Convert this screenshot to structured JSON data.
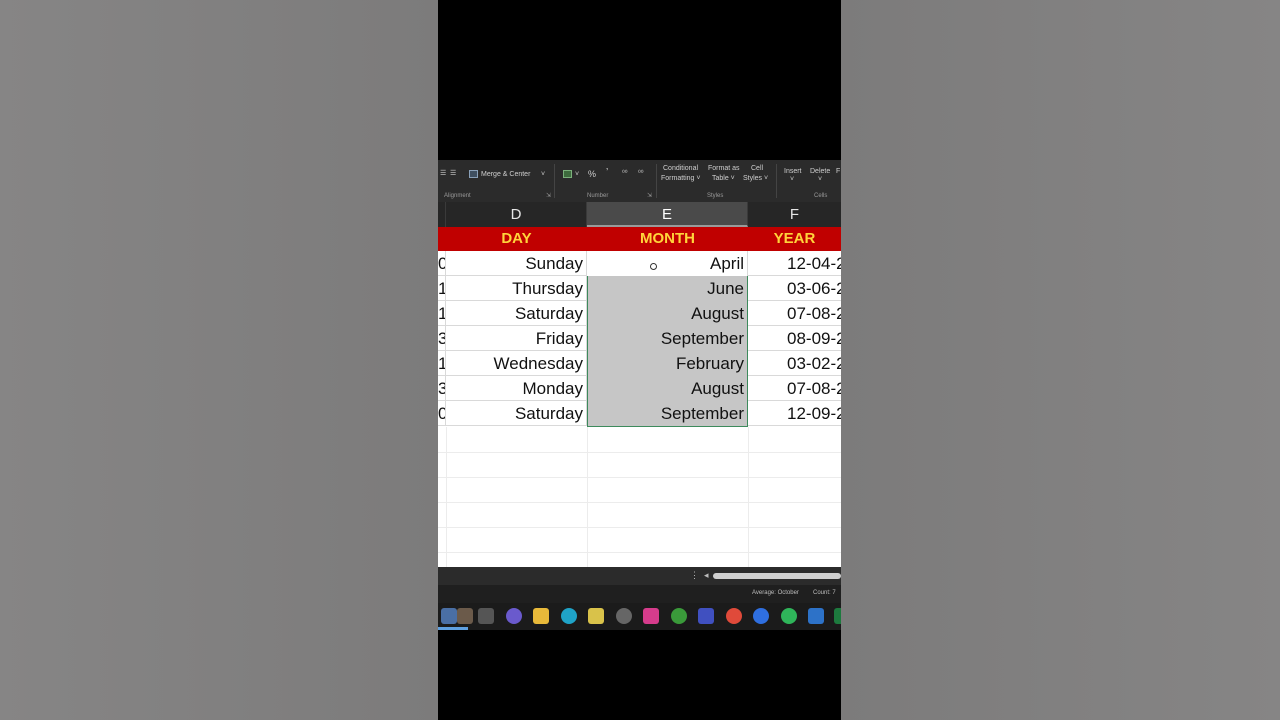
{
  "ribbon": {
    "merge_label": "Merge & Center",
    "merge_arrow": "˅",
    "percent": "%",
    "comma": "’",
    "conditional_1": "Conditional",
    "conditional_2": "Formatting ˅",
    "format_table_1": "Format as",
    "format_table_2": "Table ˅",
    "cell_styles_1": "Cell",
    "cell_styles_2": "Styles ˅",
    "insert_label": "Insert",
    "insert_arrow": "˅",
    "delete_label": "Delete",
    "delete_arrow": "˅",
    "group_alignment": "Alignment",
    "group_number": "Number",
    "group_styles": "Styles",
    "group_cells": "Cells"
  },
  "columns": [
    {
      "letter": "D"
    },
    {
      "letter": "E"
    },
    {
      "letter": "F"
    }
  ],
  "header_row": {
    "day": "DAY",
    "month": "MONTH",
    "year": "YEAR"
  },
  "rows": [
    {
      "left": "0",
      "day": "Sunday",
      "month": "April",
      "year": "12-04-2"
    },
    {
      "left": "1",
      "day": "Thursday",
      "month": "June",
      "year": "03-06-2"
    },
    {
      "left": "1",
      "day": "Saturday",
      "month": "August",
      "year": "07-08-2"
    },
    {
      "left": "3",
      "day": "Friday",
      "month": "September",
      "year": "08-09-2"
    },
    {
      "left": "1",
      "day": "Wednesday",
      "month": "February",
      "year": "03-02-2"
    },
    {
      "left": "3",
      "day": "Monday",
      "month": "August",
      "year": "07-08-2"
    },
    {
      "left": "0",
      "day": "Saturday",
      "month": "September",
      "year": "12-09-2"
    }
  ],
  "scroll": {
    "dots": "⋮",
    "left_arrow": "◂"
  },
  "status": {
    "average": "Average: October",
    "count": "Count: 7"
  },
  "taskbar_icons": [
    "store-icon",
    "chat-icon",
    "folder-icon",
    "edge-icon",
    "mail-icon",
    "settings-icon",
    "instagram-icon",
    "xbox-icon",
    "app-icon",
    "chrome-icon",
    "facebook-icon",
    "whatsapp-icon",
    "outlook-icon",
    "excel-icon"
  ],
  "colors": {
    "header_red": "#c00000",
    "header_text": "#ffd43b",
    "selection": "#c6c6c6"
  }
}
